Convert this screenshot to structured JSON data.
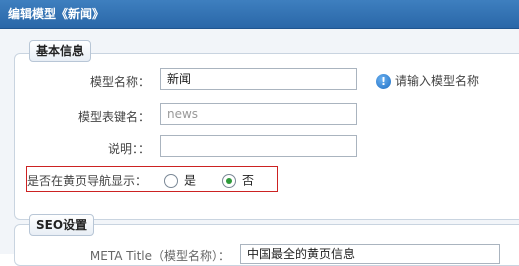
{
  "window": {
    "title": "编辑模型《新闻》"
  },
  "basic": {
    "legend": "基本信息",
    "model_name": {
      "label": "模型名称：",
      "value": "新闻",
      "tip": "请输入模型名称"
    },
    "model_table": {
      "label": "模型表键名：",
      "value": "news"
    },
    "description": {
      "label": "说明：：",
      "value": ""
    },
    "show_in_nav": {
      "label": "是否在黄页导航显示：",
      "options": [
        {
          "label": "是",
          "selected": false
        },
        {
          "label": "否",
          "selected": true
        }
      ]
    }
  },
  "seo": {
    "legend": "SEO设置",
    "meta_title": {
      "label": "META Title（模型名称）：",
      "value": "中国最全的黄页信息"
    }
  },
  "colors": {
    "title_bar": "#2f6eb0",
    "highlight_border": "#cc2222",
    "radio_checked": "#2e9a3a"
  },
  "icons": {
    "tip_icon": "info-icon"
  }
}
